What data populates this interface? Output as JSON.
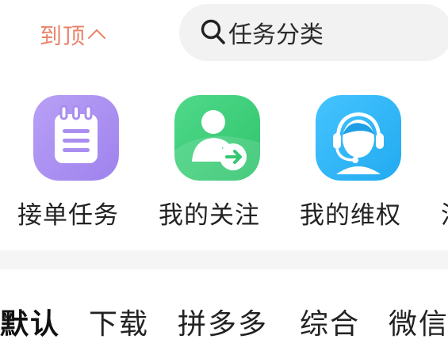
{
  "header": {
    "back_to_top_label": "到顶",
    "search_placeholder": "任务分类"
  },
  "shortcuts": [
    {
      "label": "接单任务",
      "icon": "notepad-icon",
      "color": "#a98ef0"
    },
    {
      "label": "我的关注",
      "icon": "person-follow-icon",
      "color": "#3fd17a"
    },
    {
      "label": "我的维权",
      "icon": "customer-service-icon",
      "color": "#2fb6f5"
    },
    {
      "label": "活",
      "icon": "partial-shortcut-icon",
      "color": "#222222"
    }
  ],
  "tabs": [
    {
      "label": "默认",
      "active": true
    },
    {
      "label": "下载",
      "active": false
    },
    {
      "label": "拼多多",
      "active": false
    },
    {
      "label": "综合",
      "active": false
    },
    {
      "label": "微信",
      "active": false
    }
  ],
  "colors": {
    "accent_orange": "#e8836a",
    "search_bg": "#f2f2f2",
    "band_bg": "#f5f5f5"
  }
}
